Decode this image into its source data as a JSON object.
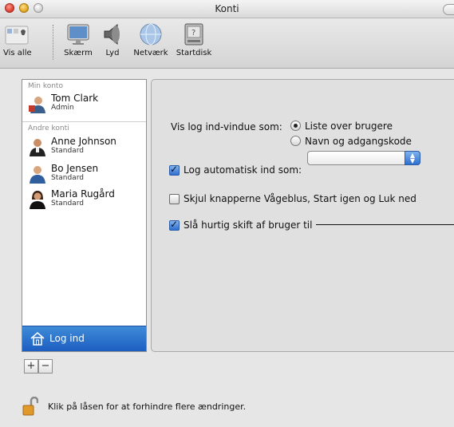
{
  "window": {
    "title": "Konti"
  },
  "toolbar": {
    "items": [
      {
        "label": "Vis alle",
        "icon": "apple-show-all-icon"
      },
      {
        "label": "Skærm",
        "icon": "display-icon"
      },
      {
        "label": "Lyd",
        "icon": "speaker-icon"
      },
      {
        "label": "Netværk",
        "icon": "network-globe-icon"
      },
      {
        "label": "Startdisk",
        "icon": "startup-disk-icon"
      }
    ]
  },
  "sidebar": {
    "my_account_header": "Min konto",
    "my_account": {
      "name": "Tom Clark",
      "role": "Admin"
    },
    "other_accounts_header": "Andre konti",
    "other_accounts": [
      {
        "name": "Anne Johnson",
        "role": "Standard"
      },
      {
        "name": "Bo Jensen",
        "role": "Standard"
      },
      {
        "name": "Maria Rugård",
        "role": "Standard"
      }
    ],
    "login_label": "Log ind",
    "add_label": "+",
    "remove_label": "−"
  },
  "options": {
    "show_login_window_label": "Vis log ind-vindue som:",
    "radio_list_label": "Liste over brugere",
    "radio_name_password_label": "Navn og adgangskode",
    "radio_selected": "Liste over brugere",
    "auto_login_label": "Log automatisk ind som:",
    "auto_login_checked": true,
    "auto_login_value": "",
    "hide_buttons_label": "Skjul knapperne Vågeblus, Start igen og Luk ned",
    "hide_buttons_checked": false,
    "fast_switch_label": "Slå hurtig skift af bruger til",
    "fast_switch_checked": true
  },
  "footer": {
    "lock_text": "Klik på låsen for at forhindre flere ændringer."
  },
  "colors": {
    "selection_blue": "#1c5ec1",
    "checkbox_blue": "#2f6fcf"
  }
}
